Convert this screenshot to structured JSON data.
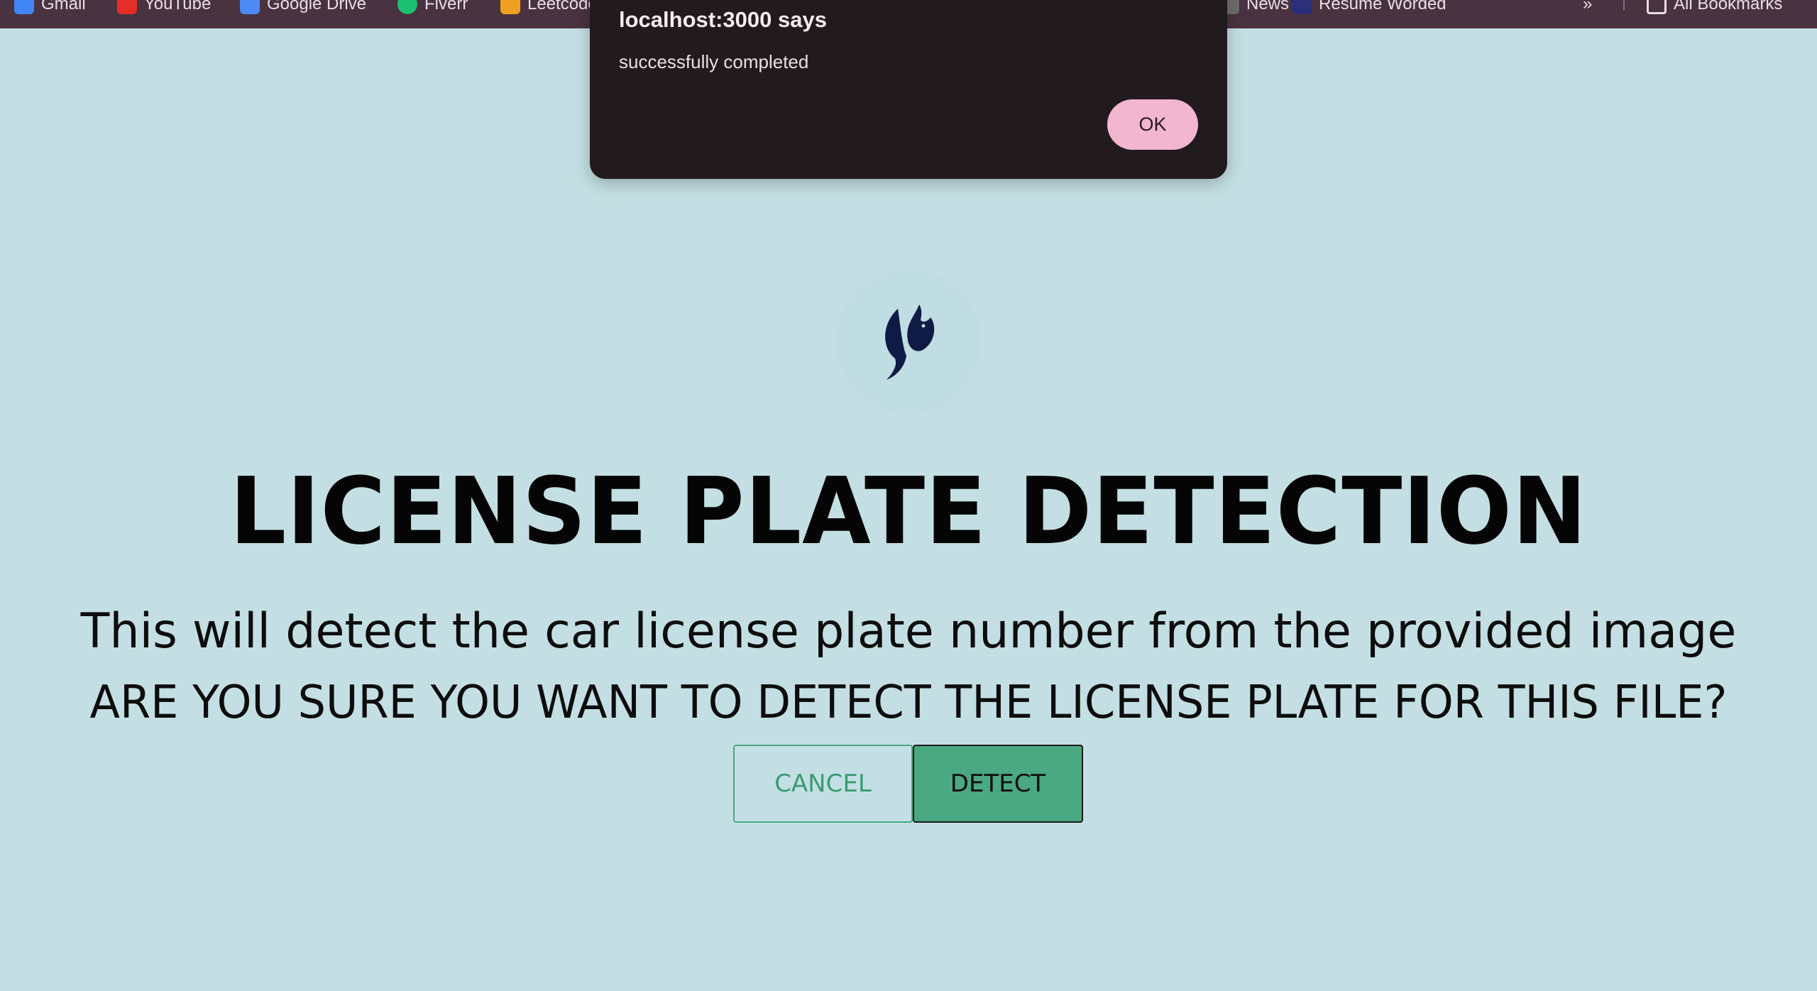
{
  "bookmarks": [
    {
      "label": "Gmail",
      "icon": "gmail-icon",
      "color": "#4285f4"
    },
    {
      "label": "YouTube",
      "icon": "youtube-icon",
      "color": "#e52d27"
    },
    {
      "label": "Google Drive",
      "icon": "google-drive-icon",
      "color": "#4c8bf5"
    },
    {
      "label": "Fiverr",
      "icon": "fiverr-icon",
      "color": "#1dbf73"
    },
    {
      "label": "Leetcode",
      "icon": "leetcode-icon",
      "color": "#f0a020"
    },
    {
      "label": "News",
      "icon": "news-icon",
      "color": "#6b6b6b"
    },
    {
      "label": "Resume Worded",
      "icon": "resume-worded-icon",
      "color": "#2b2f7a"
    }
  ],
  "bookmarks_overflow": "»",
  "all_bookmarks": {
    "label": "All Bookmarks",
    "icon": "folder-icon"
  },
  "dialog": {
    "title": "localhost:3000 says",
    "message": "successfully completed",
    "ok_label": "OK"
  },
  "page": {
    "logo": "bird-logo-icon",
    "title": "LICENSE PLATE DETECTION",
    "subtitle": "This will detect the car license plate number from the provided image",
    "question": "ARE YOU SURE YOU WANT TO DETECT THE LICENSE PLATE FOR THIS FILE?",
    "cancel_label": "CANCEL",
    "detect_label": "DETECT"
  },
  "colors": {
    "background": "#c4dfe3",
    "accent_green": "#4aa882",
    "dialog_bg": "#221b1e",
    "ok_pink": "#f2b6cf",
    "logo_navy": "#0f1a45"
  }
}
